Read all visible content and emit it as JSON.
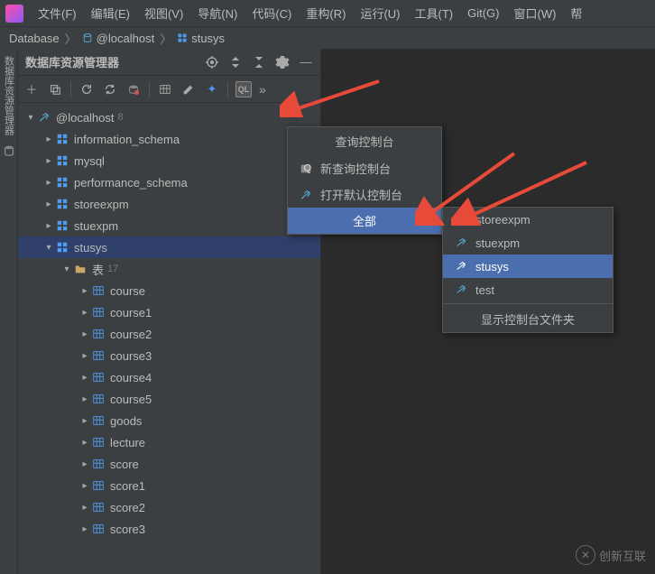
{
  "menu": [
    "文件(F)",
    "编辑(E)",
    "视图(V)",
    "导航(N)",
    "代码(C)",
    "重构(R)",
    "运行(U)",
    "工具(T)",
    "Git(G)",
    "窗口(W)",
    "帮"
  ],
  "breadcrumb": {
    "database": "Database",
    "host": "@localhost",
    "schema": "stusys"
  },
  "panel": {
    "title": "数据库资源管理器"
  },
  "left_bar": {
    "label": "数据库资源管理器"
  },
  "tree": {
    "host": "@localhost",
    "host_count": "8",
    "schemas": [
      "information_schema",
      "mysql",
      "performance_schema",
      "storeexpm",
      "stuexpm"
    ],
    "selected_schema": "stusys",
    "tables_label": "表",
    "tables_count": "17",
    "tables": [
      "course",
      "course1",
      "course2",
      "course3",
      "course4",
      "course5",
      "goods",
      "lecture",
      "score",
      "score1",
      "score2",
      "score3"
    ]
  },
  "context_menu": {
    "title": "查询控制台",
    "new_console": "新查询控制台",
    "open_default": "打开默认控制台",
    "all": "全部"
  },
  "submenu": {
    "items": [
      "storeexpm",
      "stuexpm",
      "stusys",
      "test"
    ],
    "selected": "stusys",
    "show_folder": "显示控制台文件夹"
  },
  "watermark": "创新互联"
}
